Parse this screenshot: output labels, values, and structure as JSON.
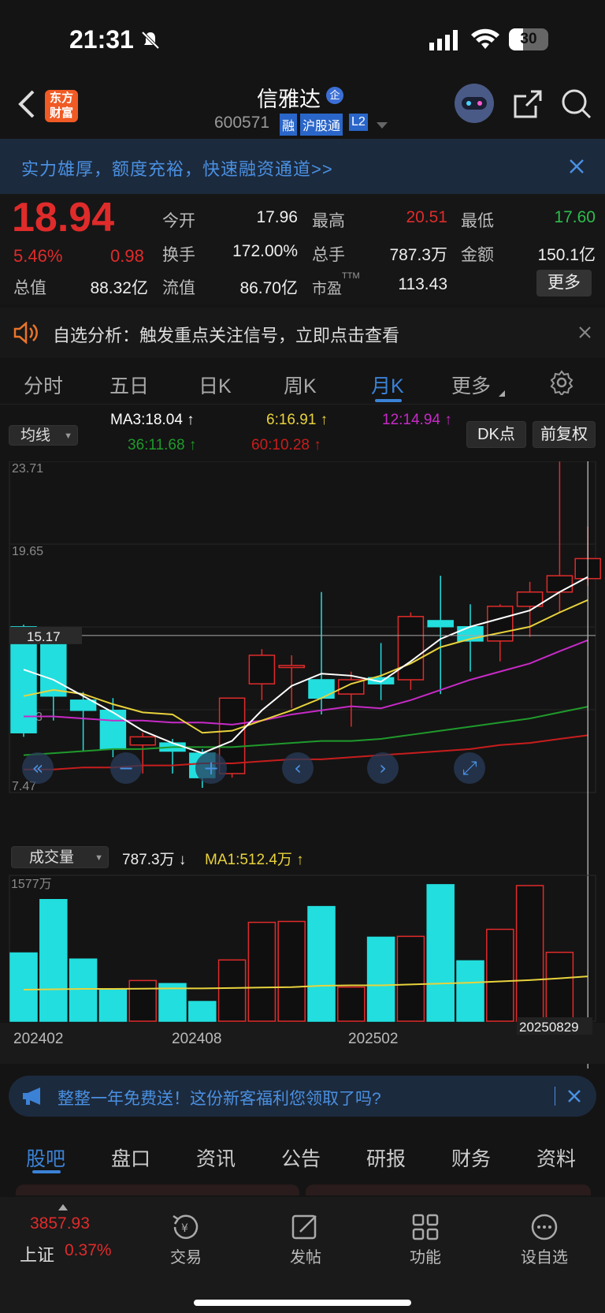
{
  "status": {
    "time": "21:31",
    "battery": "30"
  },
  "nav": {
    "logo": "东方财富",
    "stock_name": "信雅达",
    "badge": "企",
    "code": "600571",
    "tags": [
      "融",
      "沪股通",
      "L2"
    ]
  },
  "banner": {
    "text": "实力雄厚，额度充裕，快速融资通道>>"
  },
  "quote": {
    "price": "18.94",
    "pct": "5.46%",
    "change": "0.98",
    "total_value_label": "总值",
    "total_value": "88.32亿",
    "open_label": "今开",
    "open": "17.96",
    "high_label": "最高",
    "high": "20.51",
    "low_label": "最低",
    "low": "17.60",
    "turnover_label": "换手",
    "turnover": "172.00%",
    "volume_label": "总手",
    "volume": "787.3万",
    "amount_label": "金额",
    "amount": "150.1亿",
    "float_label": "流值",
    "float": "86.70亿",
    "pe_label": "市盈",
    "pe_sup": "TTM",
    "pe": "113.43",
    "more": "更多"
  },
  "notice": {
    "text": "自选分析：触发重点关注信号，立即点击查看"
  },
  "tabs": [
    "分时",
    "五日",
    "日K",
    "周K",
    "月K",
    "更多"
  ],
  "active_tab": 4,
  "ma": {
    "selector": "均线",
    "ma3": "MA3:18.04",
    "ma6": "6:16.91",
    "ma12": "12:14.94",
    "ma36": "36:11.68",
    "ma60": "60:10.28",
    "dk": "DK点",
    "fq": "前复权"
  },
  "colors": {
    "up": "#e02b2b",
    "down": "#22dede",
    "ma3": "#ffffff",
    "ma6": "#e8d23c",
    "ma12": "#c72ac7",
    "ma36": "#1f9a2b",
    "ma60": "#c81d1d",
    "accent": "#3b82d6"
  },
  "chart_data": {
    "type": "candlestick",
    "y_ticks": [
      "23.71",
      "19.65",
      "15.59",
      "11.53",
      "7.47"
    ],
    "cross_price": "15.17",
    "x_labels": [
      "202402",
      "202408",
      "202502",
      "20250829"
    ],
    "candles": [
      {
        "o": 15.6,
        "c": 10.4,
        "h": 15.7,
        "l": 10.2
      },
      {
        "o": 15.0,
        "c": 12.2,
        "h": 15.3,
        "l": 11.0
      },
      {
        "o": 12.0,
        "c": 11.5,
        "h": 12.4,
        "l": 9.5
      },
      {
        "o": 11.5,
        "c": 9.6,
        "h": 12.1,
        "l": 9.2
      },
      {
        "o": 9.8,
        "c": 10.2,
        "h": 10.4,
        "l": 8.4
      },
      {
        "o": 9.9,
        "c": 9.5,
        "h": 10.1,
        "l": 8.4
      },
      {
        "o": 9.4,
        "c": 8.2,
        "h": 9.6,
        "l": 7.7
      },
      {
        "o": 8.4,
        "c": 12.1,
        "h": 12.1,
        "l": 8.2
      },
      {
        "o": 12.8,
        "c": 14.2,
        "h": 14.5,
        "l": 12.0
      },
      {
        "o": 13.6,
        "c": 13.7,
        "h": 14.2,
        "l": 11.6
      },
      {
        "o": 13.0,
        "c": 12.1,
        "h": 17.3,
        "l": 11.3
      },
      {
        "o": 12.3,
        "c": 13.0,
        "h": 13.4,
        "l": 10.7
      },
      {
        "o": 13.1,
        "c": 12.8,
        "h": 14.8,
        "l": 12.0
      },
      {
        "o": 13.0,
        "c": 16.1,
        "h": 16.3,
        "l": 12.5
      },
      {
        "o": 15.9,
        "c": 15.6,
        "h": 18.1,
        "l": 12.3
      },
      {
        "o": 15.6,
        "c": 14.9,
        "h": 16.7,
        "l": 13.4
      },
      {
        "o": 14.9,
        "c": 16.6,
        "h": 16.7,
        "l": 13.9
      },
      {
        "o": 16.6,
        "c": 17.3,
        "h": 17.8,
        "l": 15.1
      },
      {
        "o": 17.3,
        "c": 18.1,
        "h": 23.7,
        "l": 16.3
      },
      {
        "o": 17.96,
        "c": 18.94,
        "h": 20.51,
        "l": 17.6
      }
    ],
    "ma3": [
      13.5,
      13.0,
      12.2,
      11.4,
      10.5,
      9.9,
      9.4,
      10.0,
      11.5,
      12.7,
      13.3,
      13.2,
      12.9,
      13.9,
      15.0,
      15.6,
      16.0,
      16.4,
      17.3,
      18.04
    ],
    "ma6": [
      12.2,
      12.5,
      12.3,
      11.8,
      11.4,
      11.3,
      10.4,
      10.5,
      11.0,
      11.5,
      12.1,
      12.8,
      13.2,
      13.8,
      14.6,
      15.0,
      15.3,
      15.6,
      16.3,
      16.91
    ],
    "ma12": [
      11.2,
      11.2,
      11.1,
      11.0,
      11.0,
      10.9,
      10.9,
      10.8,
      11.0,
      11.3,
      11.5,
      11.7,
      11.6,
      12.0,
      12.5,
      13.0,
      13.4,
      13.8,
      14.4,
      14.94
    ],
    "ma36": [
      9.3,
      9.4,
      9.5,
      9.6,
      9.6,
      9.7,
      9.7,
      9.7,
      9.8,
      9.9,
      10.0,
      10.0,
      10.1,
      10.3,
      10.5,
      10.7,
      10.9,
      11.1,
      11.4,
      11.68
    ],
    "ma60": [
      8.6,
      8.6,
      8.7,
      8.7,
      8.8,
      8.8,
      8.9,
      8.9,
      9.0,
      9.1,
      9.1,
      9.2,
      9.3,
      9.4,
      9.5,
      9.6,
      9.8,
      9.9,
      10.1,
      10.28
    ]
  },
  "volume": {
    "selector": "成交量",
    "value": "787.3万",
    "ma1": "MA1:512.4万",
    "max_label": "1577万",
    "values": [
      780,
      1390,
      710,
      370,
      465,
      430,
      225,
      700,
      1130,
      1140,
      1310,
      390,
      960,
      970,
      1560,
      690,
      1050,
      1550,
      787.3,
      null
    ],
    "ma1_values": [
      360,
      365,
      370,
      370,
      372,
      375,
      375,
      380,
      385,
      390,
      405,
      410,
      410,
      420,
      430,
      440,
      455,
      470,
      490,
      512.4
    ],
    "max": 1577
  },
  "promo": {
    "text": "整整一年免费送！这份新客福利您领取了吗?"
  },
  "bottom_tabs": [
    "股吧",
    "盘口",
    "资讯",
    "公告",
    "研报",
    "财务",
    "资料"
  ],
  "dock": {
    "index_value": "3857.93",
    "index_name": "上证",
    "index_pct": "0.37%",
    "items": [
      "交易",
      "发帖",
      "功能",
      "设自选"
    ]
  }
}
